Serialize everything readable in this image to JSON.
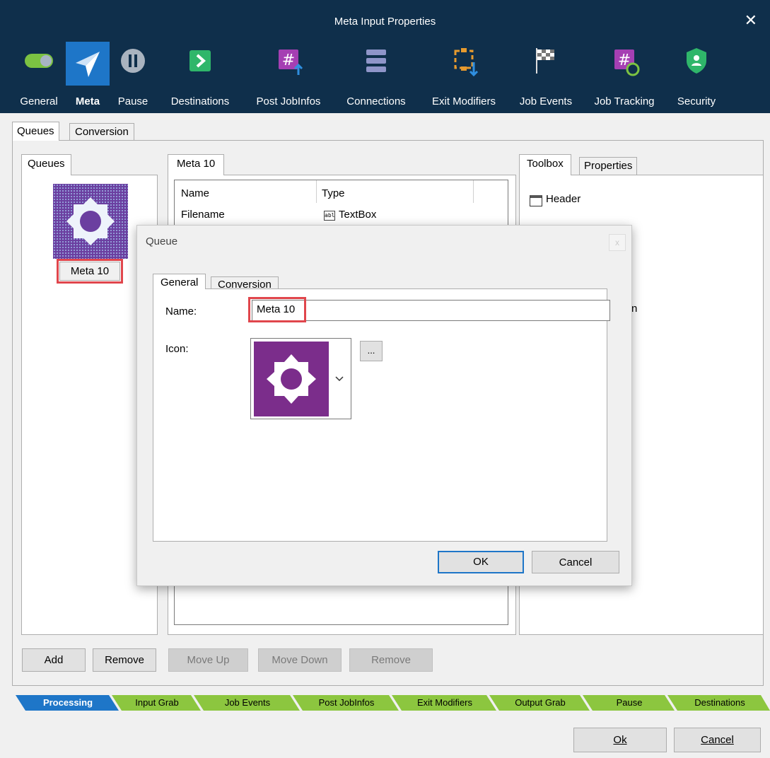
{
  "window": {
    "title": "Meta Input Properties",
    "close_glyph": "✕"
  },
  "toolbar": [
    {
      "label": "General",
      "icon": "toggle-icon"
    },
    {
      "label": "Meta",
      "icon": "paper-plane-icon",
      "active": true
    },
    {
      "label": "Pause",
      "icon": "pause-icon"
    },
    {
      "label": "Destinations",
      "icon": "arrow-right-icon"
    },
    {
      "label": "Post JobInfos",
      "icon": "hash-upload-icon"
    },
    {
      "label": "Connections",
      "icon": "stack-icon"
    },
    {
      "label": "Exit Modifiers",
      "icon": "exit-modifier-icon"
    },
    {
      "label": "Job Events",
      "icon": "checkered-flag-icon"
    },
    {
      "label": "Job Tracking",
      "icon": "hash-clock-icon"
    },
    {
      "label": "Security",
      "icon": "shield-user-icon"
    }
  ],
  "outer_tabs": [
    "Queues",
    "Conversion"
  ],
  "queues_panel": {
    "tab": "Queues",
    "item_label": "Meta 10"
  },
  "meta_panel": {
    "tab": "Meta 10",
    "columns": [
      "Name",
      "Type"
    ],
    "rows": [
      {
        "name": "Filename",
        "type": "TextBox",
        "type_icon_text": "abl"
      }
    ]
  },
  "toolbox_panel": {
    "tabs": [
      "Toolbox",
      "Properties"
    ],
    "items": [
      {
        "label": "Header"
      }
    ],
    "partial_text": "n"
  },
  "buttons": {
    "add": "Add",
    "remove_queue": "Remove",
    "move_up": "Move Up",
    "move_down": "Move Down",
    "remove_field": "Remove"
  },
  "dialog": {
    "title": "Queue",
    "close_glyph": "x",
    "tabs": [
      "General",
      "Conversion"
    ],
    "name_label": "Name:",
    "name_value": "Meta 10",
    "icon_label": "Icon:",
    "browse_label": "...",
    "ok": "OK",
    "cancel": "Cancel"
  },
  "process_steps": [
    "Processing",
    "Input Grab",
    "Job Events",
    "Post JobInfos",
    "Exit Modifiers",
    "Output Grab",
    "Pause",
    "Destinations"
  ],
  "footer": {
    "ok": "Ok",
    "cancel": "Cancel"
  },
  "colors": {
    "title_bg": "#0f2f4b",
    "active_tool": "#1e76c8",
    "queue_icon_bg": "#6b3fa0",
    "dialog_icon_bg": "#7b2d8b",
    "step_active": "#1e76c8",
    "step_green": "#8cc63f",
    "highlight": "#e0464c"
  }
}
